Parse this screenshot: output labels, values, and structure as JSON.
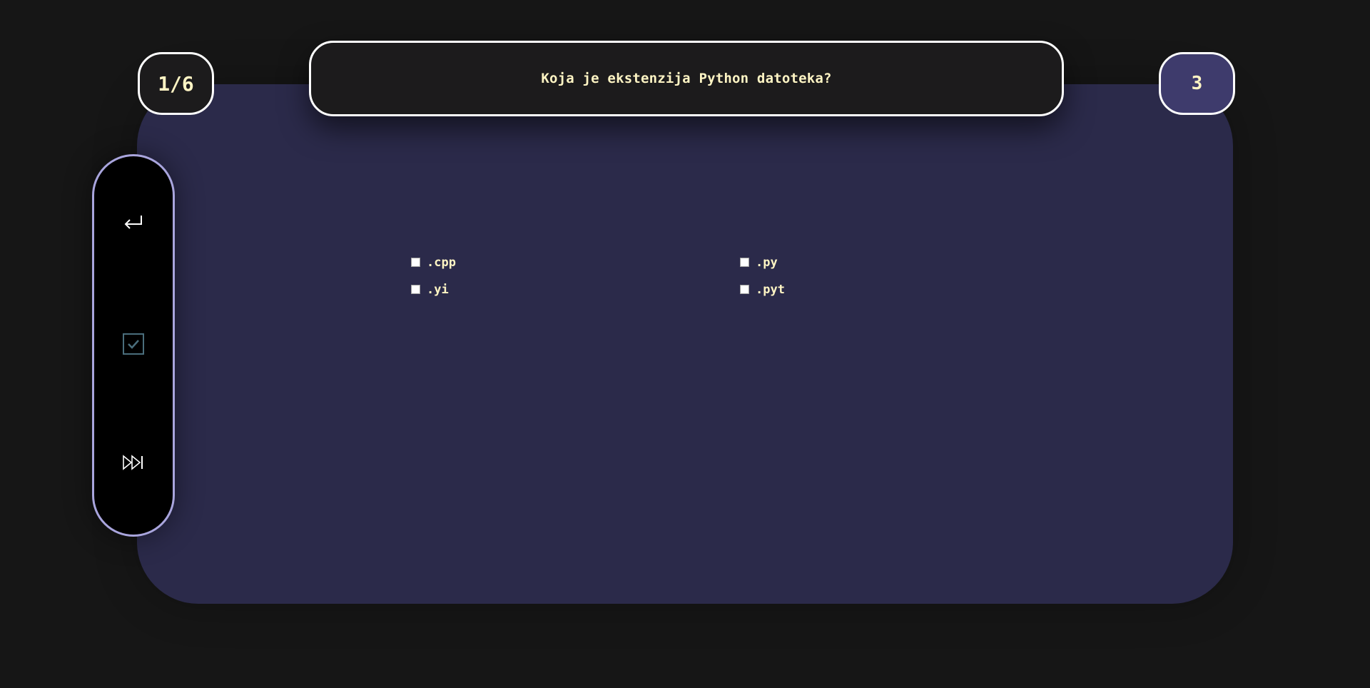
{
  "quiz": {
    "counter": "1/6",
    "score": "3",
    "question": "Koja je ekstenzija Python datoteka?",
    "answers": [
      {
        "label": ".cpp",
        "checked": false
      },
      {
        "label": ".py",
        "checked": false
      },
      {
        "label": ".yi",
        "checked": false
      },
      {
        "label": ".pyt",
        "checked": false
      }
    ]
  },
  "sidebar": {
    "buttons": [
      {
        "icon": "return-arrow-icon"
      },
      {
        "icon": "checkbox-check-icon"
      },
      {
        "icon": "fast-forward-icon"
      }
    ]
  },
  "colors": {
    "background": "#161616",
    "card": "#2b2a4a",
    "question_box": "#1c1b1c",
    "text": "#fff5c4",
    "score_box": "#3e3b6c",
    "sidebar_border": "#a9a5dd"
  }
}
